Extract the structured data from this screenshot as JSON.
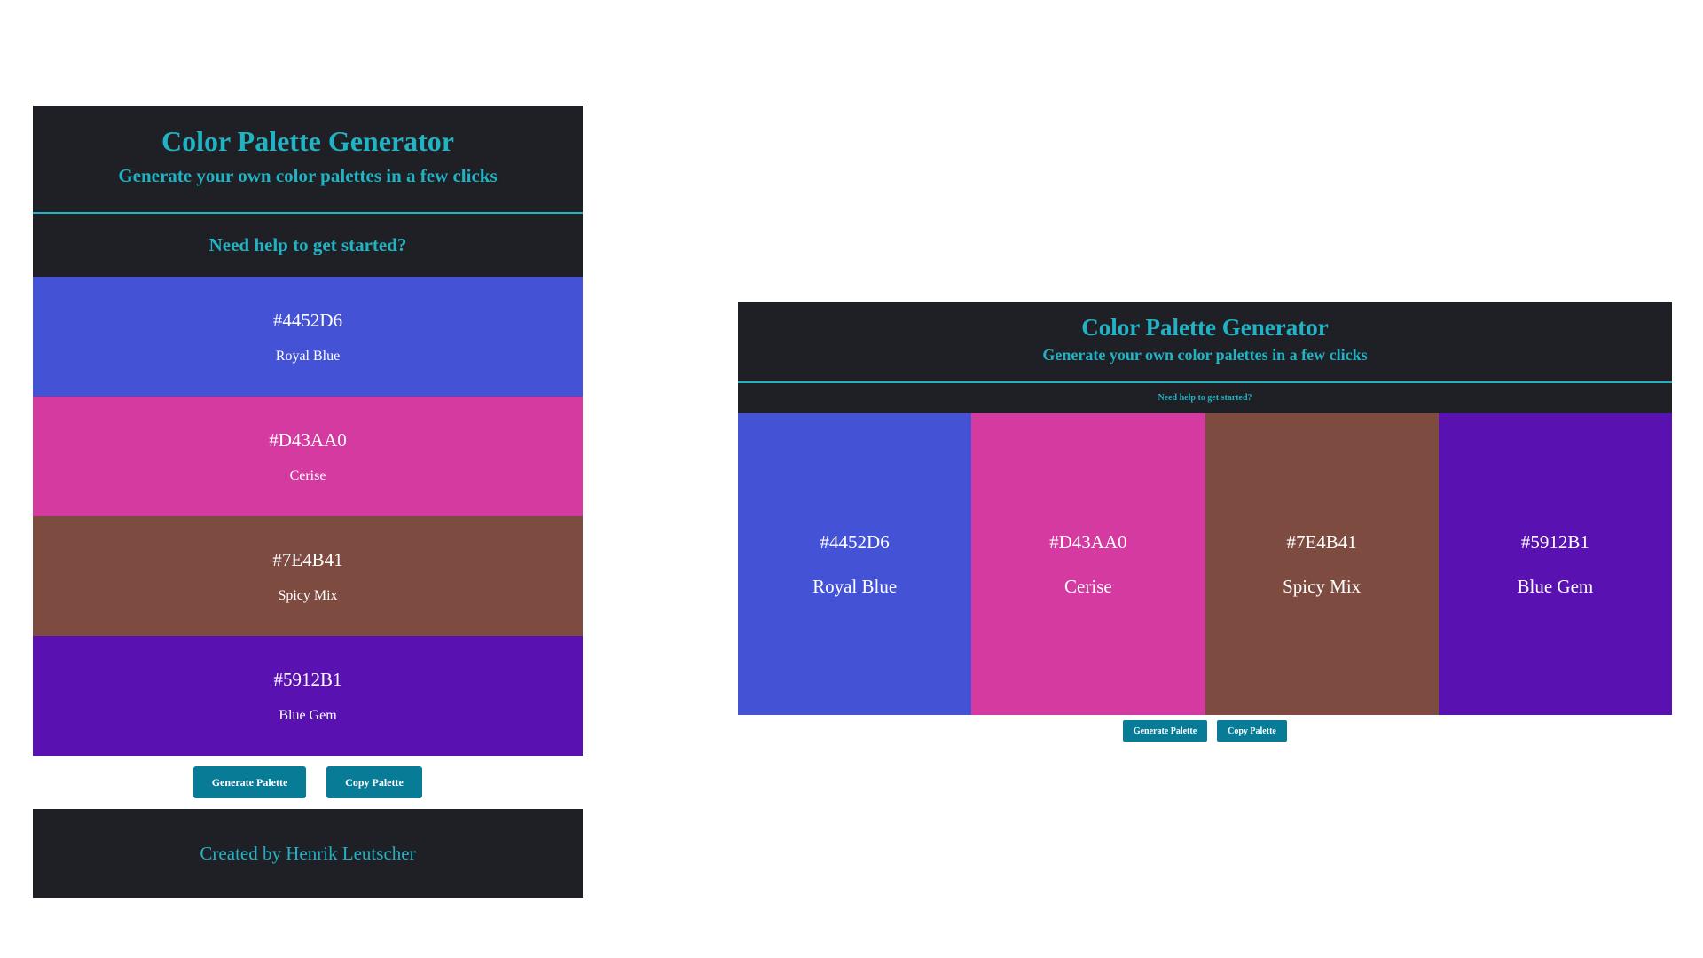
{
  "app": {
    "title": "Color Palette Generator",
    "subtitle": "Generate your own color palettes in a few clicks",
    "help_link": "Need help to get started?",
    "footer": "Created by Henrik Leutscher"
  },
  "colors": {
    "background_dark": "#1f2026",
    "accent": "#21b3c4",
    "button": "#087b96"
  },
  "palette": [
    {
      "hex": "#4452D6",
      "name": "Royal Blue"
    },
    {
      "hex": "#D43AA0",
      "name": "Cerise"
    },
    {
      "hex": "#7E4B41",
      "name": "Spicy Mix"
    },
    {
      "hex": "#5912B1",
      "name": "Blue Gem"
    }
  ],
  "buttons": {
    "generate": "Generate Palette",
    "copy": "Copy Palette"
  }
}
